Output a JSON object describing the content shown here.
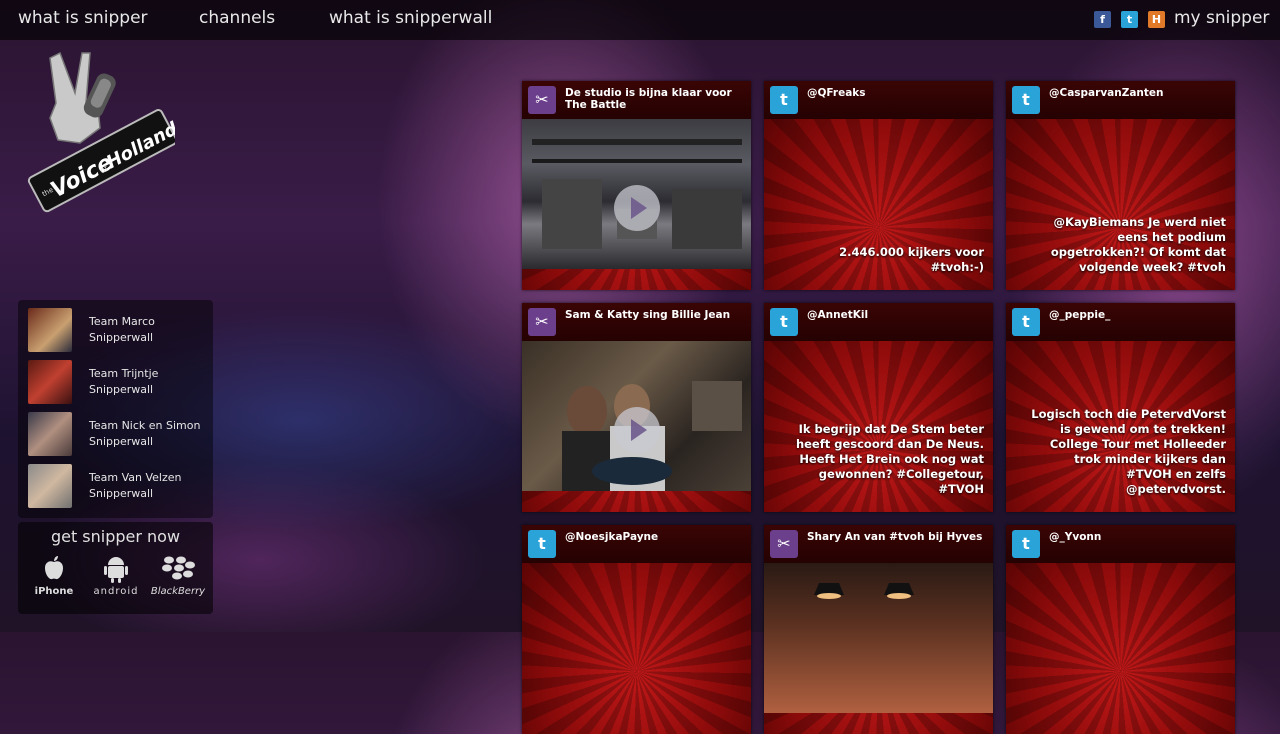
{
  "nav": {
    "links": [
      "what is snipper",
      "channels",
      "what is snipperwall"
    ],
    "social": [
      "facebook-icon",
      "twitter-icon",
      "hyves-icon"
    ],
    "my_snipper": "my snipper"
  },
  "logo": {
    "text_line1": "the",
    "text_line2": "Voice",
    "text_line3": "of",
    "text_line4": "Holland"
  },
  "teams": [
    {
      "name": "Team Marco",
      "sub": "Snipperwall"
    },
    {
      "name": "Team Trijntje",
      "sub": "Snipperwall"
    },
    {
      "name": "Team Nick en Simon",
      "sub": "Snipperwall"
    },
    {
      "name": "Team Van Velzen",
      "sub": "Snipperwall"
    }
  ],
  "get_app": {
    "title": "get snipper now",
    "platforms": [
      "iPhone",
      "android",
      "BlackBerry"
    ]
  },
  "tiles": [
    {
      "type": "video",
      "title": "De studio is bijna klaar voor The Battle"
    },
    {
      "type": "tweet",
      "user": "@QFreaks",
      "text": "2.446.000 kijkers voor #tvoh:-)"
    },
    {
      "type": "tweet",
      "user": "@CasparvanZanten",
      "text": "@KayBiemans Je werd niet eens het podium opgetrokken?! Of komt dat volgende week? #tvoh"
    },
    {
      "type": "video",
      "title": "Sam & Katty sing Billie Jean"
    },
    {
      "type": "tweet",
      "user": "@AnnetKil",
      "text": "Ik begrijp dat De Stem beter heeft gescoord dan De Neus. Heeft Het Brein ook nog wat gewonnen? #Collegetour, #TVOH"
    },
    {
      "type": "tweet",
      "user": "@_peppie_",
      "text": "Logisch toch die PetervdVorst is gewend om te trekken! College Tour met Holleeder trok minder kijkers dan #TVOH en zelfs @petervdvorst."
    },
    {
      "type": "tweet",
      "user": "@NoesjkaPayne",
      "text": ""
    },
    {
      "type": "video",
      "title": "Shary An van #tvoh bij Hyves"
    },
    {
      "type": "tweet",
      "user": "@_Yvonn",
      "text": ""
    }
  ]
}
